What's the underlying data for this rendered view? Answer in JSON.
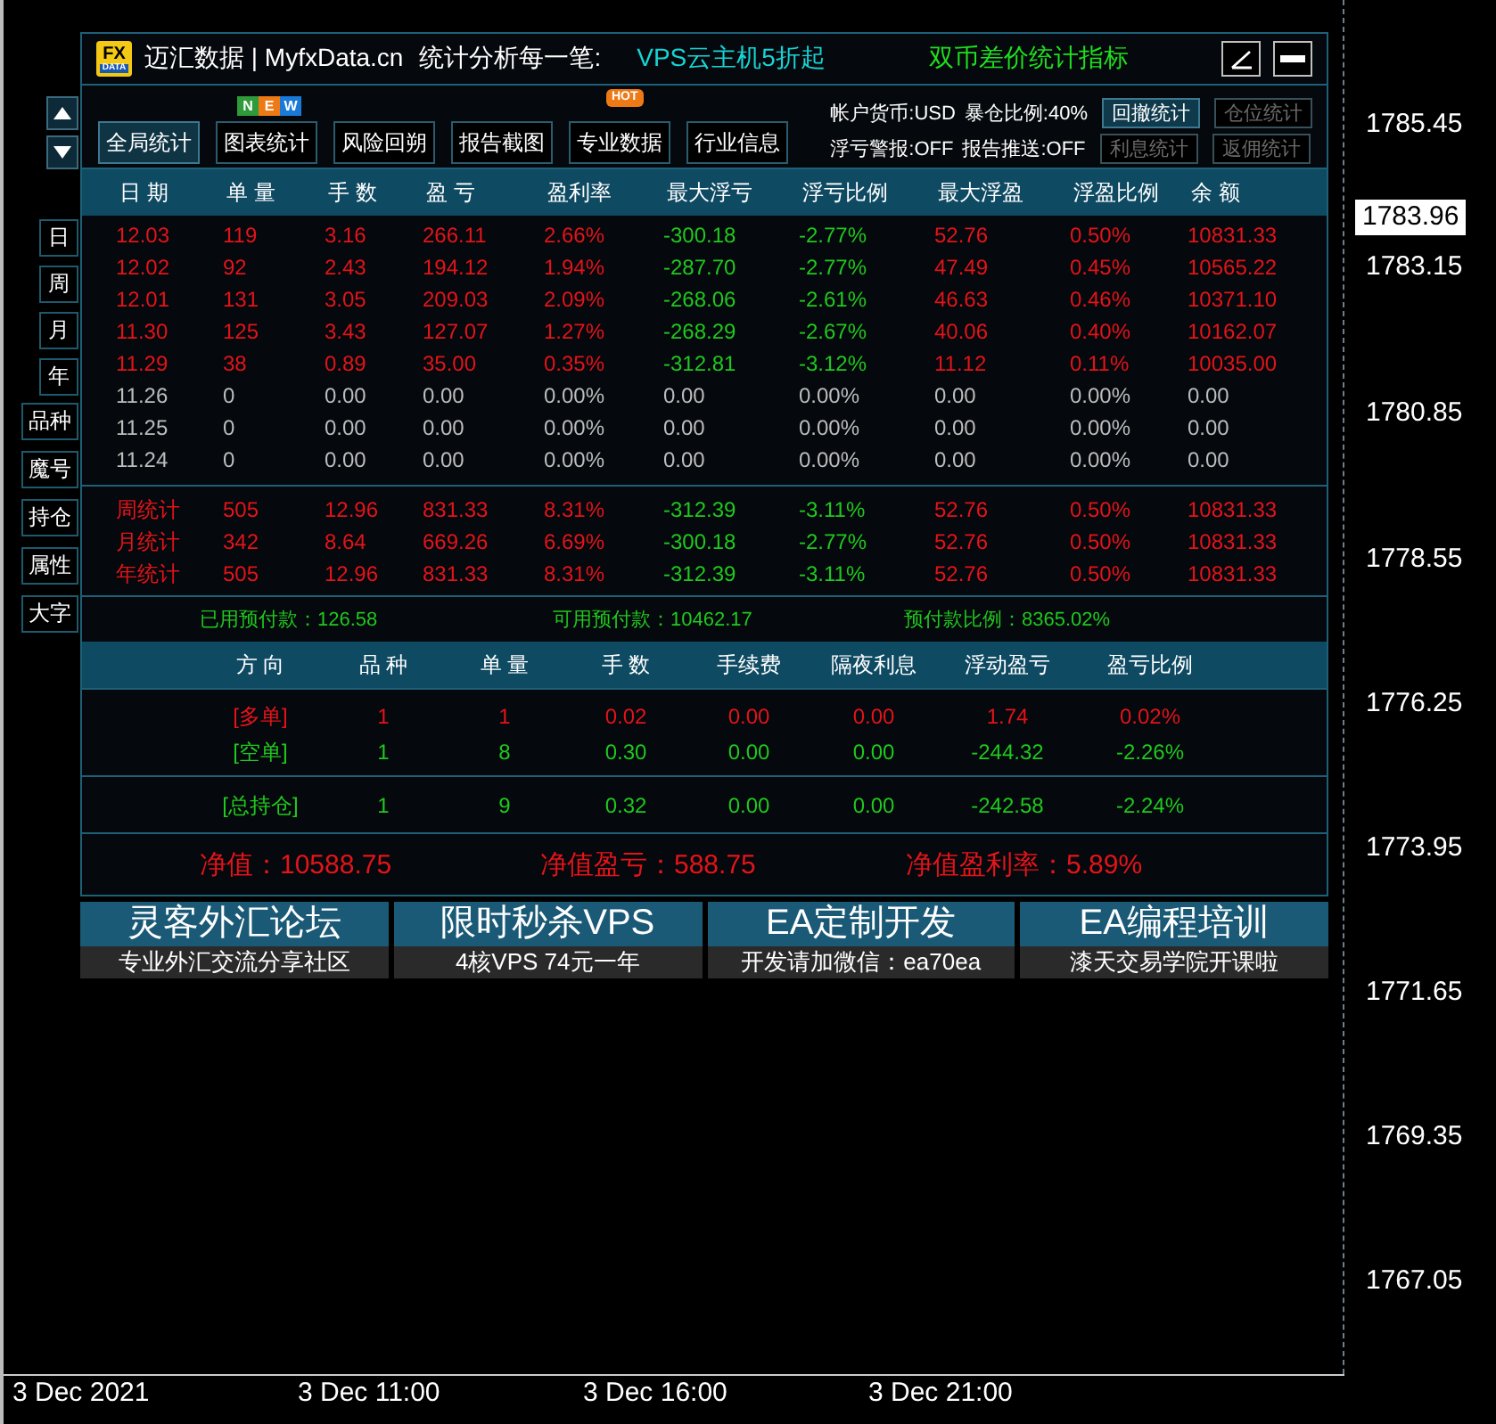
{
  "chart": {
    "price_labels": [
      {
        "text": "1785.45",
        "current": false
      },
      {
        "text": "1783.96",
        "current": true
      },
      {
        "text": "1783.15",
        "current": false
      },
      {
        "text": "1780.85",
        "current": false
      },
      {
        "text": "1778.55",
        "current": false
      },
      {
        "text": "1776.25",
        "current": false
      },
      {
        "text": "1773.95",
        "current": false
      },
      {
        "text": "1771.65",
        "current": false
      },
      {
        "text": "1769.35",
        "current": false
      },
      {
        "text": "1767.05",
        "current": false
      }
    ],
    "time_labels": [
      "3 Dec 2021",
      "3 Dec 11:00",
      "3 Dec 16:00",
      "3 Dec 21:00"
    ]
  },
  "side_controls": {
    "period_buttons": [
      "日",
      "周",
      "月",
      "年"
    ],
    "option_buttons": [
      "品种",
      "魔号",
      "持仓",
      "属性",
      "大字"
    ]
  },
  "panel": {
    "logo": [
      "FX",
      "DATA"
    ],
    "title": "迈汇数据 | MyfxData.cn",
    "slogan": "统计分析每一笔:",
    "promo": "VPS云主机5折起",
    "indicator_name": "双币差价统计指标",
    "tabs": [
      {
        "label": "全局统计",
        "selected": true
      },
      {
        "label": "图表统计",
        "selected": false,
        "badge": {
          "kind": "letters",
          "letters": [
            {
              "text": "N",
              "color": "#2e9a3a"
            },
            {
              "text": "E",
              "color": "#ee7a16"
            },
            {
              "text": "W",
              "color": "#1a7ad8"
            }
          ]
        }
      },
      {
        "label": "风险回朔",
        "selected": false
      },
      {
        "label": "报告截图",
        "selected": false
      },
      {
        "label": "专业数据",
        "selected": false,
        "badge": {
          "kind": "tag",
          "text": "HOT"
        }
      },
      {
        "label": "行业信息",
        "selected": false
      }
    ],
    "account_info": [
      [
        "帐户货币:USD",
        "暴仓比例:40%"
      ],
      [
        "浮亏警报:OFF",
        "报告推送:OFF"
      ]
    ],
    "stat_buttons": [
      [
        {
          "label": "回撤统计",
          "disabled": false
        },
        {
          "label": "仓位统计",
          "disabled": true
        }
      ],
      [
        {
          "label": "利息统计",
          "disabled": true
        },
        {
          "label": "返佣统计",
          "disabled": true
        }
      ]
    ],
    "daily_table": {
      "columns": [
        "日 期",
        "单 量",
        "手 数",
        "盈 亏",
        "盈利率",
        "最大浮亏",
        "浮亏比例",
        "最大浮盈",
        "浮盈比例",
        "余 额"
      ],
      "rows": [
        {
          "kind": "profit",
          "cells": [
            "12.03",
            "119",
            "3.16",
            "266.11",
            "2.66%",
            "-300.18",
            "-2.77%",
            "52.76",
            "0.50%",
            "10831.33"
          ]
        },
        {
          "kind": "profit",
          "cells": [
            "12.02",
            "92",
            "2.43",
            "194.12",
            "1.94%",
            "-287.70",
            "-2.77%",
            "47.49",
            "0.45%",
            "10565.22"
          ]
        },
        {
          "kind": "profit",
          "cells": [
            "12.01",
            "131",
            "3.05",
            "209.03",
            "2.09%",
            "-268.06",
            "-2.61%",
            "46.63",
            "0.46%",
            "10371.10"
          ]
        },
        {
          "kind": "profit",
          "cells": [
            "11.30",
            "125",
            "3.43",
            "127.07",
            "1.27%",
            "-268.29",
            "-2.67%",
            "40.06",
            "0.40%",
            "10162.07"
          ]
        },
        {
          "kind": "profit",
          "cells": [
            "11.29",
            "38",
            "0.89",
            "35.00",
            "0.35%",
            "-312.81",
            "-3.12%",
            "11.12",
            "0.11%",
            "10035.00"
          ]
        },
        {
          "kind": "flat",
          "cells": [
            "11.26",
            "0",
            "0.00",
            "0.00",
            "0.00%",
            "0.00",
            "0.00%",
            "0.00",
            "0.00%",
            "0.00"
          ]
        },
        {
          "kind": "flat",
          "cells": [
            "11.25",
            "0",
            "0.00",
            "0.00",
            "0.00%",
            "0.00",
            "0.00%",
            "0.00",
            "0.00%",
            "0.00"
          ]
        },
        {
          "kind": "flat",
          "cells": [
            "11.24",
            "0",
            "0.00",
            "0.00",
            "0.00%",
            "0.00",
            "0.00%",
            "0.00",
            "0.00%",
            "0.00"
          ]
        }
      ],
      "summary_rows": [
        {
          "kind": "profit",
          "cells": [
            "周统计",
            "505",
            "12.96",
            "831.33",
            "8.31%",
            "-312.39",
            "-3.11%",
            "52.76",
            "0.50%",
            "10831.33"
          ]
        },
        {
          "kind": "profit",
          "cells": [
            "月统计",
            "342",
            "8.64",
            "669.26",
            "6.69%",
            "-300.18",
            "-2.77%",
            "52.76",
            "0.50%",
            "10831.33"
          ]
        },
        {
          "kind": "profit",
          "cells": [
            "年统计",
            "505",
            "12.96",
            "831.33",
            "8.31%",
            "-312.39",
            "-3.11%",
            "52.76",
            "0.50%",
            "10831.33"
          ]
        }
      ]
    },
    "prepay": [
      "已用预付款：126.58",
      "可用预付款：10462.17",
      "预付款比例：8365.02%"
    ],
    "positions": {
      "columns": [
        "方 向",
        "品 种",
        "单 量",
        "手 数",
        "手续费",
        "隔夜利息",
        "浮动盈亏",
        "盈亏比例"
      ],
      "rows": [
        {
          "kind": "long",
          "cells": [
            "[多单]",
            "1",
            "1",
            "0.02",
            "0.00",
            "0.00",
            "1.74",
            "0.02%"
          ]
        },
        {
          "kind": "short",
          "cells": [
            "[空单]",
            "1",
            "8",
            "0.30",
            "0.00",
            "0.00",
            "-244.32",
            "-2.26%"
          ]
        },
        {
          "kind": "total",
          "cells": [
            "[总持仓]",
            "1",
            "9",
            "0.32",
            "0.00",
            "0.00",
            "-242.58",
            "-2.24%"
          ]
        }
      ]
    },
    "equity": [
      "净值：10588.75",
      "净值盈亏：588.75",
      "净值盈利率：5.89%"
    ]
  },
  "ads": [
    {
      "title": "灵客外汇论坛",
      "subtitle": "专业外汇交流分享社区"
    },
    {
      "title": "限时秒杀VPS",
      "subtitle": "4核VPS 74元一年"
    },
    {
      "title": "EA定制开发",
      "subtitle": "开发请加微信：ea70ea"
    },
    {
      "title": "EA编程培训",
      "subtitle": "漆天交易学院开课啦"
    }
  ]
}
